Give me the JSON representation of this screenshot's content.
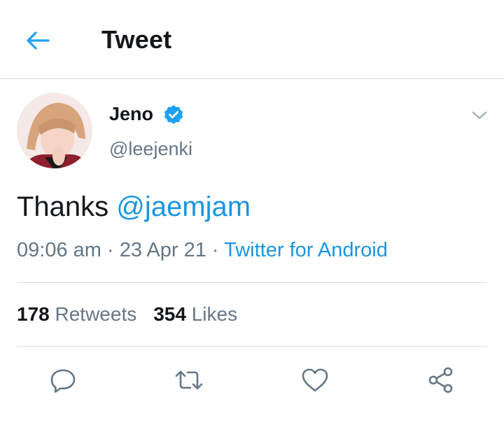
{
  "header": {
    "title": "Tweet",
    "back_icon": "arrow-left-icon",
    "accent_color": "#1da1f2"
  },
  "tweet": {
    "author": {
      "display_name": "Jeno",
      "handle": "@leejenki",
      "verified": true
    },
    "text": "Thanks ",
    "mention": "@jaemjam",
    "time": "09:06 am",
    "date": "23 Apr 21",
    "source": "Twitter for Android"
  },
  "stats": {
    "retweets_count": "178",
    "retweets_label": "Retweets",
    "likes_count": "354",
    "likes_label": "Likes"
  },
  "actions": [
    "reply-icon",
    "retweet-icon",
    "like-icon",
    "share-icon"
  ],
  "colors": {
    "text": "#14171a",
    "secondary": "#657786",
    "link": "#1b95e0",
    "divider": "#d6dde3"
  }
}
